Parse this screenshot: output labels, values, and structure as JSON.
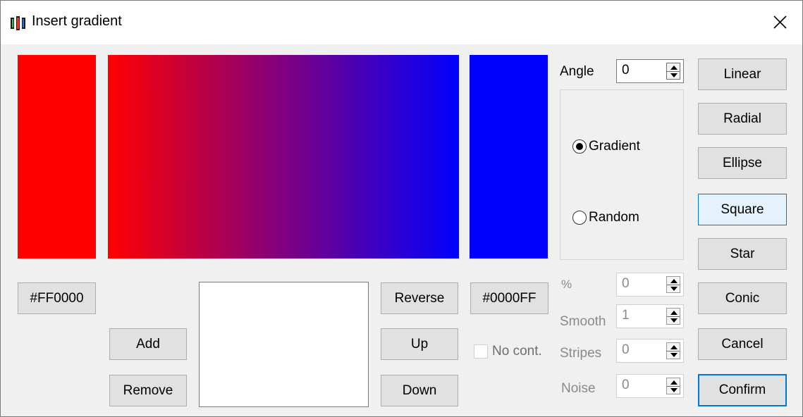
{
  "window": {
    "title": "Insert gradient",
    "icon": "paint-bars-icon",
    "close_icon": "close-icon"
  },
  "colors": {
    "start": "#FF0000",
    "end": "#0000FF"
  },
  "start_color": {
    "label": "#FF0000"
  },
  "end_color": {
    "label": "#0000FF"
  },
  "stops": {
    "add_label": "Add",
    "remove_label": "Remove",
    "items": []
  },
  "order": {
    "reverse_label": "Reverse",
    "up_label": "Up",
    "down_label": "Down"
  },
  "angle": {
    "label": "Angle",
    "value": "0"
  },
  "mode": {
    "gradient_label": "Gradient",
    "random_label": "Random",
    "selected": "Gradient"
  },
  "no_cont": {
    "label": "No cont.",
    "checked": false,
    "enabled": false
  },
  "params": {
    "percent": {
      "label": "%",
      "value": "0"
    },
    "smooth": {
      "label": "Smooth",
      "value": "1"
    },
    "stripes": {
      "label": "Stripes",
      "value": "0"
    },
    "noise": {
      "label": "Noise",
      "value": "0"
    }
  },
  "shapes": {
    "linear": "Linear",
    "radial": "Radial",
    "ellipse": "Ellipse",
    "square": "Square",
    "star": "Star",
    "conic": "Conic"
  },
  "actions": {
    "cancel": "Cancel",
    "confirm": "Confirm"
  }
}
